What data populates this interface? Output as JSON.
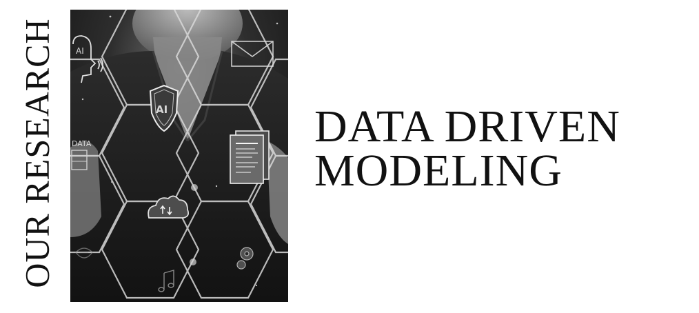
{
  "side_label": "OUR RESEARCH",
  "headline": {
    "line1": "DATA DRIVEN",
    "line2": "MODELING"
  },
  "image": {
    "icons": {
      "ai_head": "AI",
      "ai_shield": "AI",
      "data": "DATA"
    },
    "icon_names": [
      "ai-head-icon",
      "mail-icon",
      "ai-shield-icon",
      "data-icon",
      "document-icon",
      "cloud-sync-icon",
      "gear-icon",
      "music-icon"
    ]
  }
}
